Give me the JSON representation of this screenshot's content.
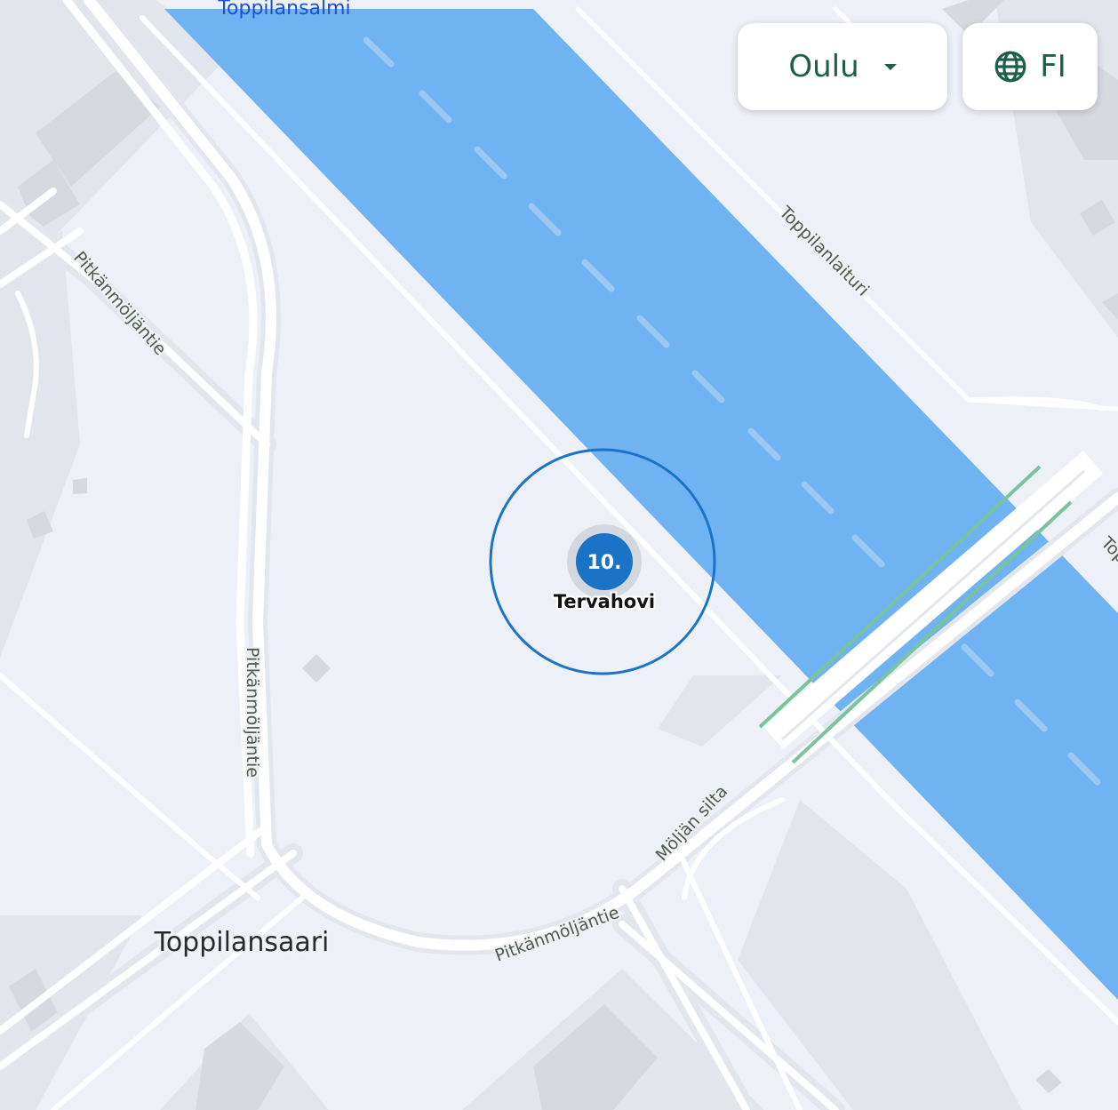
{
  "header": {
    "city_select": {
      "value": "Oulu",
      "icon": "chevron-down-icon"
    },
    "language_button": {
      "label": "FI",
      "icon": "globe-icon"
    }
  },
  "map": {
    "water_label": "Toppilansalmi",
    "area_label": "Toppilansaari",
    "street_labels": {
      "pitkanmoljantie_nw": "Pitkänmöljäntie",
      "pitkanmoljantie_vertical": "Pitkänmöljäntie",
      "pitkanmoljantie_south": "Pitkänmöljäntie",
      "toppilanlaituri": "Toppilanlaituri",
      "moljan_silta": "Möljän silta",
      "edge_label": "Top"
    },
    "marker": {
      "number": "10.",
      "name": "Tervahovi"
    },
    "colors": {
      "land": "#eef0f7",
      "block": "#e2e5eb",
      "building": "#d6d9de",
      "water": "#6fb3f2",
      "water_dash": "#9cc8f4",
      "road": "#ffffff",
      "bridge_rail": "#79c49d",
      "marker_fill": "#1a73c7",
      "marker_ring": "#1a73c7"
    }
  }
}
